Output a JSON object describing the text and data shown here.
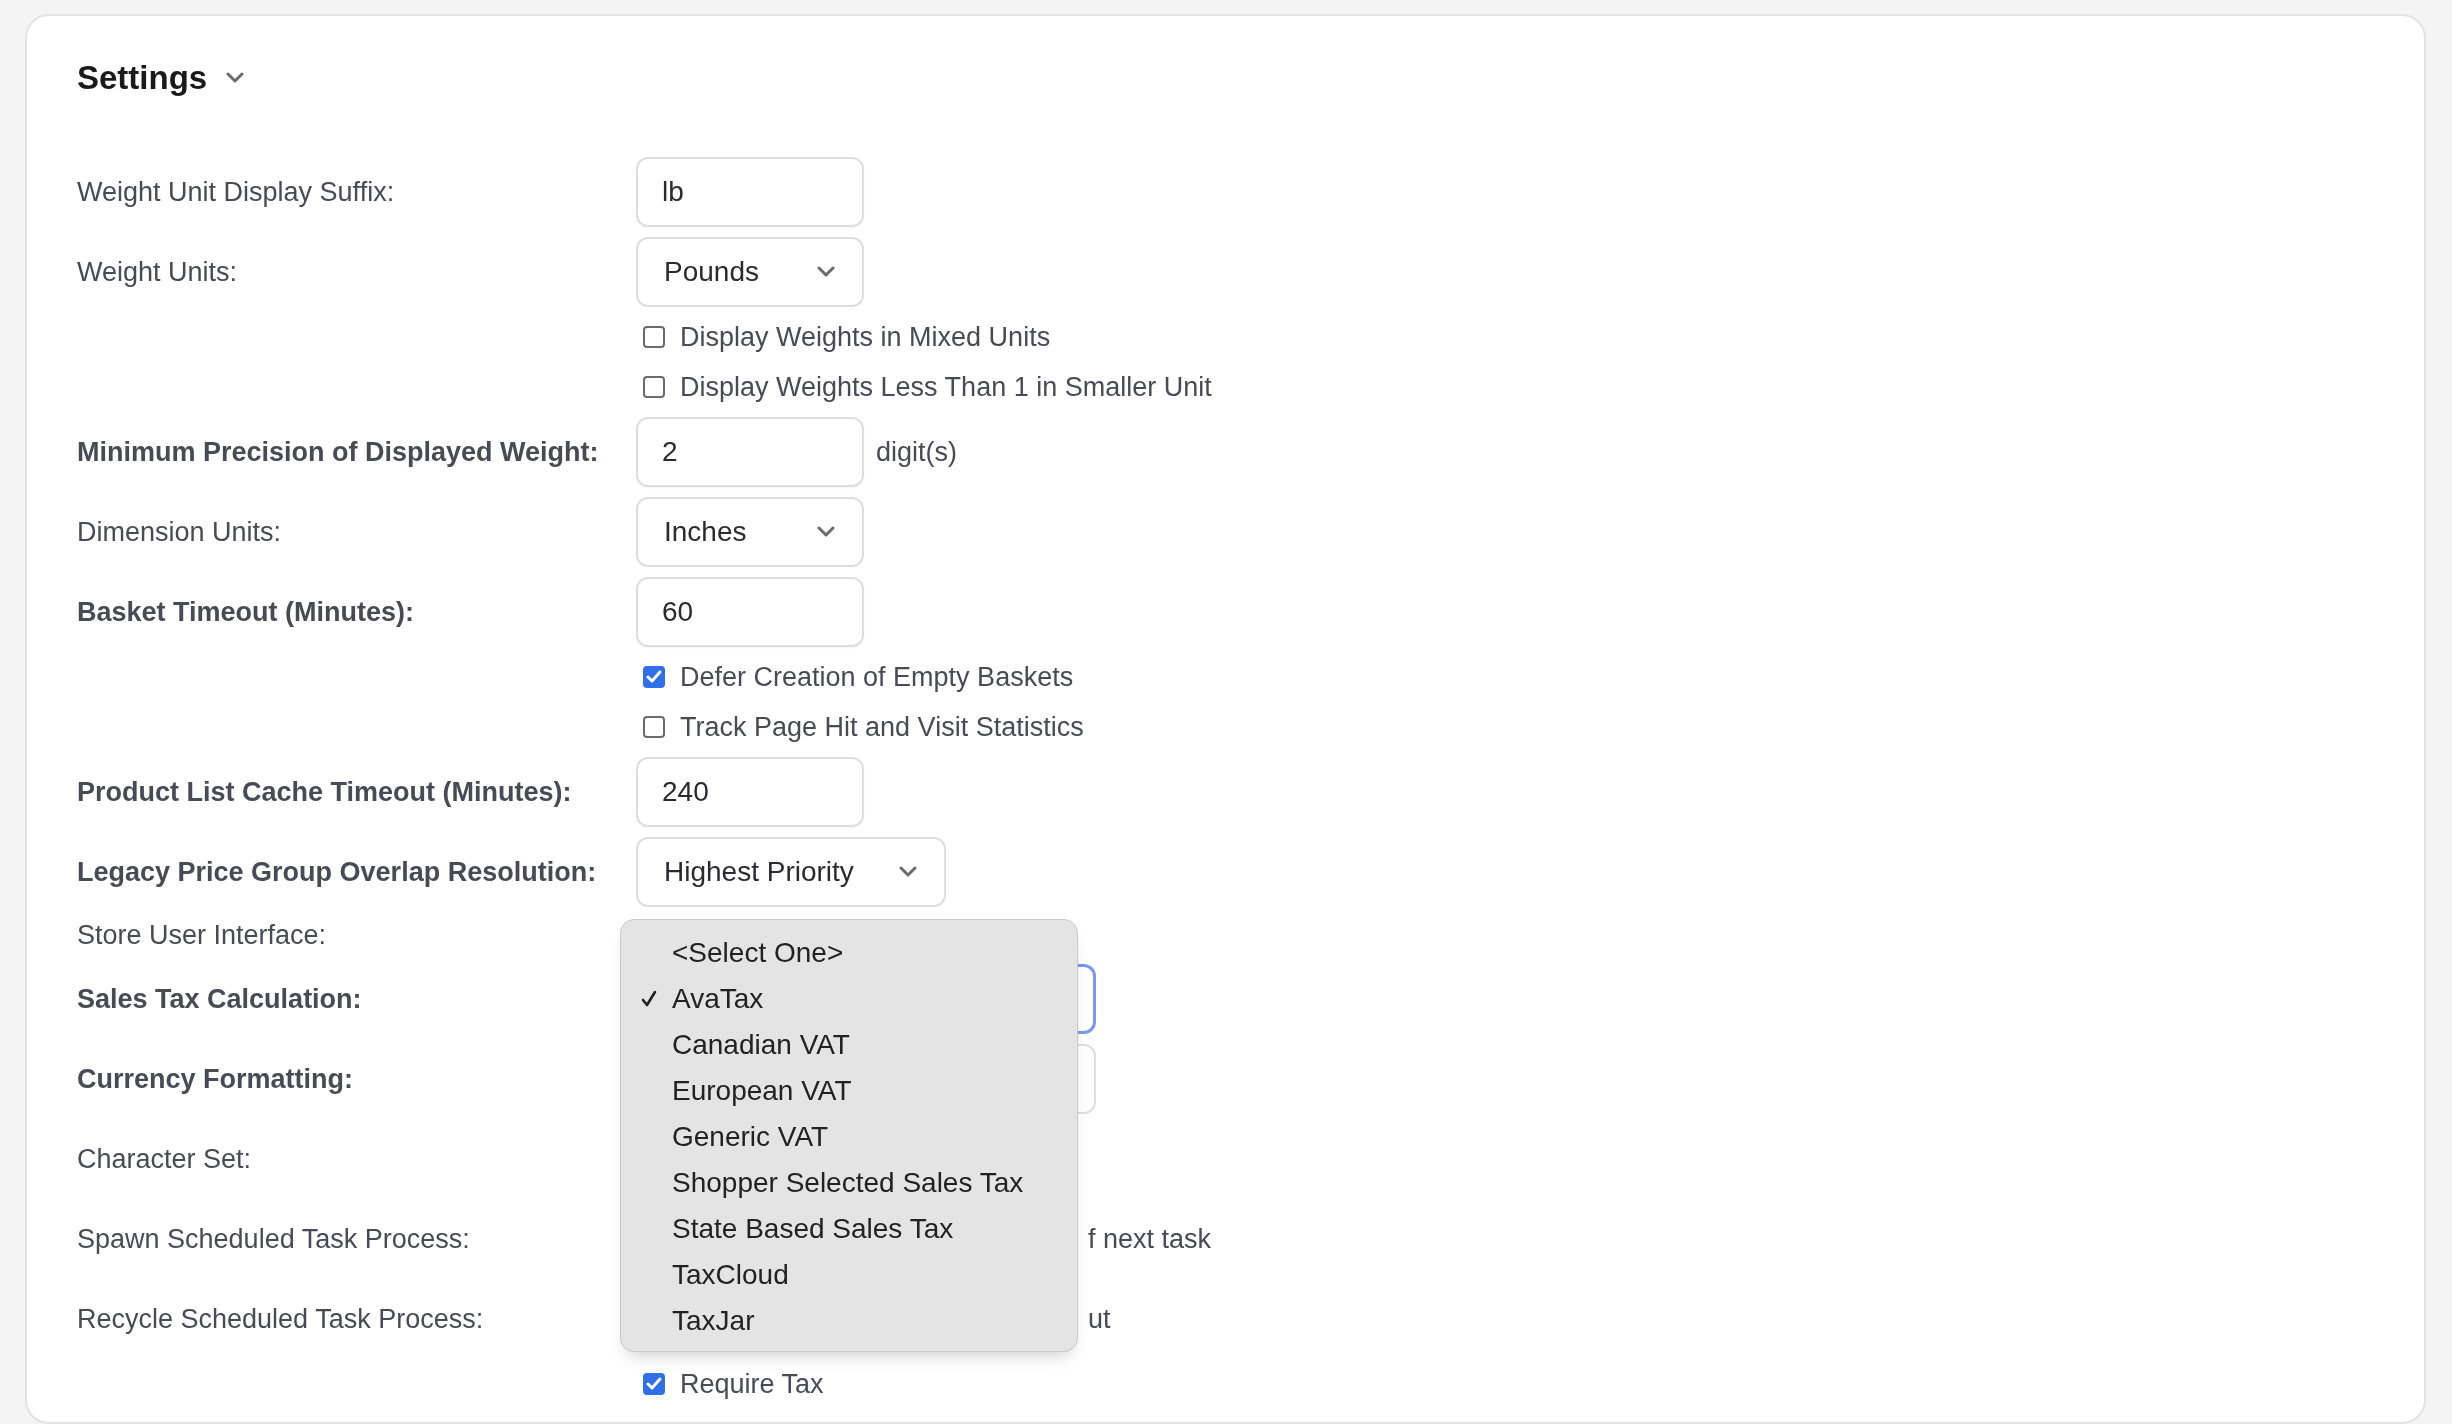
{
  "section": {
    "title": "Settings",
    "expanded": true
  },
  "rows": [
    {
      "kind": "text",
      "label": "Weight Unit Display Suffix:",
      "bold": false,
      "value": "lb"
    },
    {
      "kind": "select",
      "label": "Weight Units:",
      "bold": false,
      "value": "Pounds"
    },
    {
      "kind": "checkbox",
      "text": "Display Weights in Mixed Units",
      "checked": false
    },
    {
      "kind": "checkbox",
      "text": "Display Weights Less Than 1 in Smaller Unit",
      "checked": false
    },
    {
      "kind": "text",
      "label": "Minimum Precision of Displayed Weight:",
      "bold": true,
      "value": "2",
      "suffix": "digit(s)"
    },
    {
      "kind": "select",
      "label": "Dimension Units:",
      "bold": false,
      "value": "Inches"
    },
    {
      "kind": "text",
      "label": "Basket Timeout (Minutes):",
      "bold": true,
      "value": "60"
    },
    {
      "kind": "checkbox",
      "text": "Defer Creation of Empty Baskets",
      "checked": true
    },
    {
      "kind": "checkbox",
      "text": "Track Page Hit and Visit Statistics",
      "checked": false
    },
    {
      "kind": "text",
      "label": "Product List Cache Timeout (Minutes):",
      "bold": true,
      "value": "240"
    },
    {
      "kind": "select",
      "label": "Legacy Price Group Overlap Resolution:",
      "bold": true,
      "value": "Highest Priority"
    },
    {
      "kind": "label",
      "label": "Store User Interface:",
      "bold": false
    },
    {
      "kind": "select",
      "label": "Sales Tax Calculation:",
      "bold": true,
      "focused": true
    },
    {
      "kind": "select",
      "label": "Currency Formatting:",
      "bold": true,
      "focused": false
    },
    {
      "kind": "covered",
      "label": "Character Set:",
      "bold": false
    },
    {
      "kind": "covered",
      "label": "Spawn Scheduled Task Process:",
      "bold": false,
      "visible_text": "f next task"
    },
    {
      "kind": "covered",
      "label": "Recycle Scheduled Task Process:",
      "bold": false,
      "visible_text": "ut"
    },
    {
      "kind": "checkbox",
      "text": "Require Tax",
      "checked": true
    }
  ],
  "dropdown": {
    "options": [
      {
        "label": "<Select One>",
        "selected": false
      },
      {
        "label": "AvaTax",
        "selected": true
      },
      {
        "label": "Canadian VAT",
        "selected": false
      },
      {
        "label": "European VAT",
        "selected": false
      },
      {
        "label": "Generic VAT",
        "selected": false
      },
      {
        "label": "Shopper Selected Sales Tax",
        "selected": false
      },
      {
        "label": "State Based Sales Tax",
        "selected": false
      },
      {
        "label": "TaxCloud",
        "selected": false
      },
      {
        "label": "TaxJar",
        "selected": false
      }
    ]
  }
}
